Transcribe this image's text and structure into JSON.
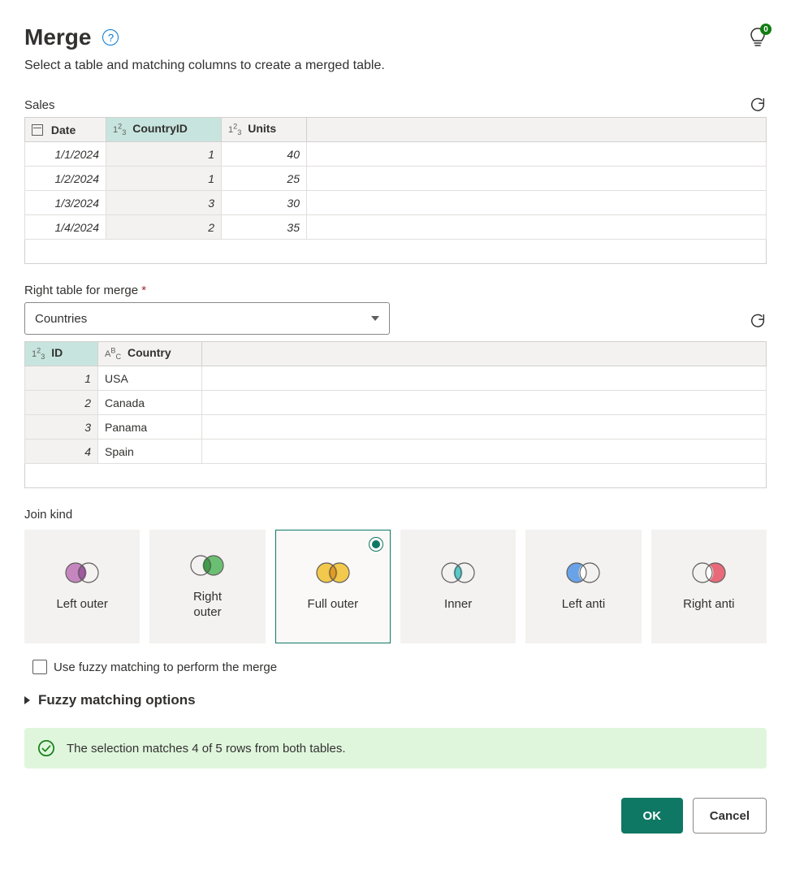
{
  "title": "Merge",
  "subtitle": "Select a table and matching columns to create a merged table.",
  "bulbCount": "0",
  "leftTable": {
    "name": "Sales",
    "columns": [
      {
        "label": "Date",
        "type": "date",
        "selected": false
      },
      {
        "label": "CountryID",
        "type": "number",
        "selected": true
      },
      {
        "label": "Units",
        "type": "number",
        "selected": false
      }
    ],
    "rows": [
      [
        "1/1/2024",
        "1",
        "40"
      ],
      [
        "1/2/2024",
        "1",
        "25"
      ],
      [
        "1/3/2024",
        "3",
        "30"
      ],
      [
        "1/4/2024",
        "2",
        "35"
      ]
    ]
  },
  "rightTableLabel": "Right table for merge",
  "rightTable": {
    "selected": "Countries",
    "columns": [
      {
        "label": "ID",
        "type": "number",
        "selected": true
      },
      {
        "label": "Country",
        "type": "text",
        "selected": false
      }
    ],
    "rows": [
      [
        "1",
        "USA"
      ],
      [
        "2",
        "Canada"
      ],
      [
        "3",
        "Panama"
      ],
      [
        "4",
        "Spain"
      ]
    ]
  },
  "joinKindLabel": "Join kind",
  "joinKinds": [
    {
      "label": "Left outer",
      "selected": false
    },
    {
      "label": "Right outer",
      "selected": false
    },
    {
      "label": "Full outer",
      "selected": true
    },
    {
      "label": "Inner",
      "selected": false
    },
    {
      "label": "Left anti",
      "selected": false
    },
    {
      "label": "Right anti",
      "selected": false
    }
  ],
  "fuzzyCheckboxLabel": "Use fuzzy matching to perform the merge",
  "fuzzyExpandLabel": "Fuzzy matching options",
  "statusMessage": "The selection matches 4 of 5 rows from both tables.",
  "okLabel": "OK",
  "cancelLabel": "Cancel"
}
